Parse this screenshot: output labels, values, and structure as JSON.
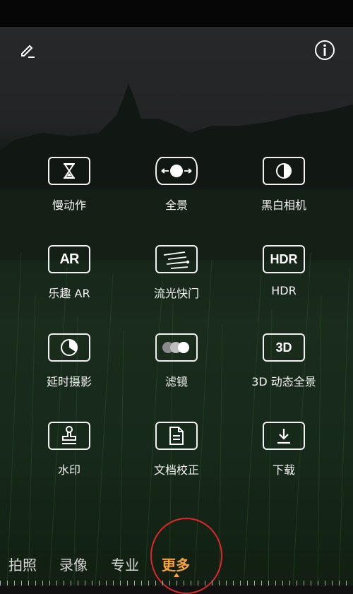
{
  "header": {
    "edit_icon": "edit-pencil-icon",
    "info_icon": "info-icon"
  },
  "modes": [
    {
      "id": "slow-motion",
      "label": "慢动作",
      "icon": "hourglass-icon"
    },
    {
      "id": "panorama",
      "label": "全景",
      "icon": "panorama-icon"
    },
    {
      "id": "monochrome",
      "label": "黑白相机",
      "icon": "half-circle-icon"
    },
    {
      "id": "ar-fun",
      "label": "乐趣 AR",
      "icon": "ar-icon",
      "icon_text": "AR"
    },
    {
      "id": "light-painting",
      "label": "流光快门",
      "icon": "light-trails-icon"
    },
    {
      "id": "hdr",
      "label": "HDR",
      "icon": "hdr-icon",
      "icon_text": "HDR"
    },
    {
      "id": "time-lapse",
      "label": "延时摄影",
      "icon": "time-lapse-icon"
    },
    {
      "id": "filter",
      "label": "滤镜",
      "icon": "filter-circles-icon"
    },
    {
      "id": "3d-panorama",
      "label": "3D 动态全景",
      "icon": "3d-icon",
      "icon_text": "3D"
    },
    {
      "id": "watermark",
      "label": "水印",
      "icon": "stamp-icon"
    },
    {
      "id": "document",
      "label": "文档校正",
      "icon": "document-icon"
    },
    {
      "id": "download",
      "label": "下载",
      "icon": "download-icon"
    }
  ],
  "tabs": [
    {
      "label": "拍照",
      "active": false
    },
    {
      "label": "录像",
      "active": false
    },
    {
      "label": "专业",
      "active": false
    },
    {
      "label": "更多",
      "active": true
    }
  ],
  "colors": {
    "active_tab": "#f7a23a",
    "highlight_ring": "#e0262a"
  }
}
